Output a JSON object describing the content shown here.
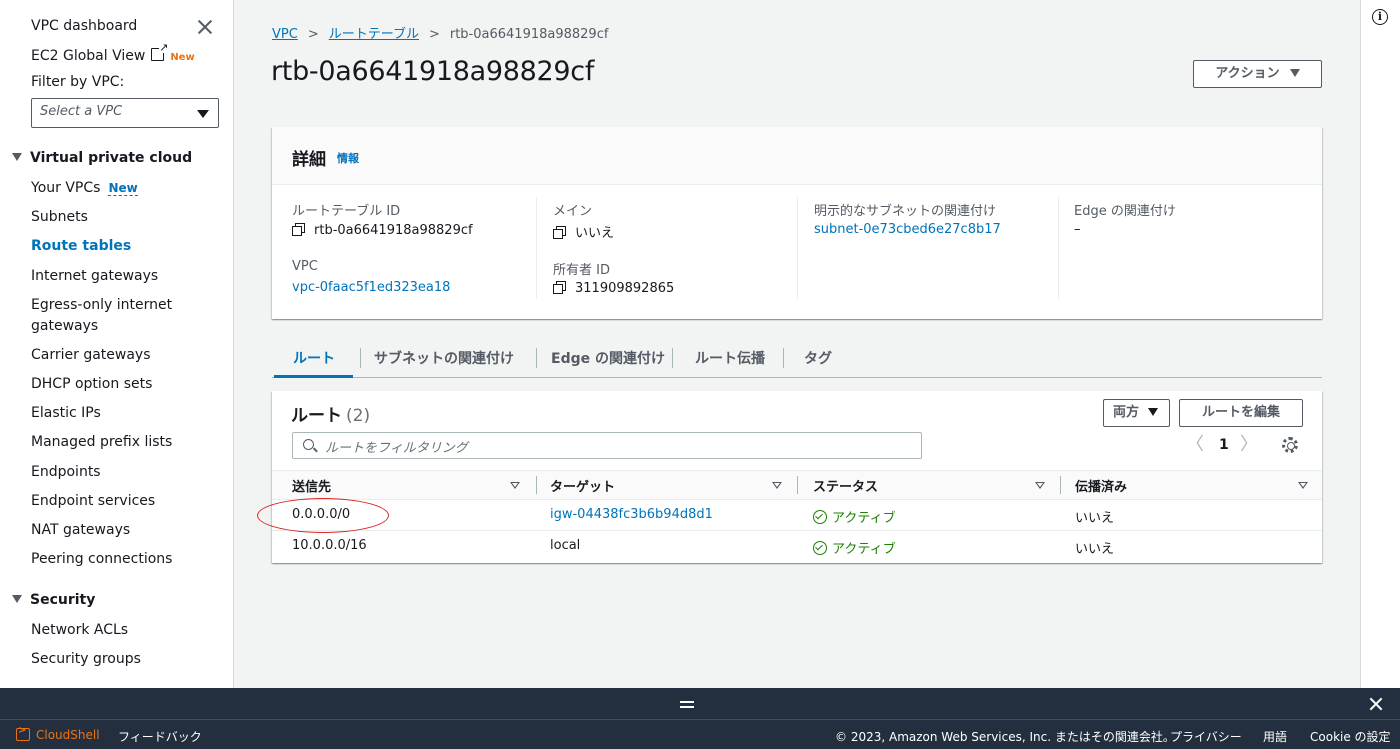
{
  "sidebar": {
    "dashboard": "VPC dashboard",
    "ec2_global_view": "EC2 Global View",
    "new_badge": "New",
    "filter_label": "Filter by VPC:",
    "filter_placeholder": "Select a VPC",
    "section_vpc": "Virtual private cloud",
    "items": [
      {
        "label": "Your VPCs",
        "badge": "New"
      },
      {
        "label": "Subnets"
      },
      {
        "label": "Route tables"
      },
      {
        "label": "Internet gateways"
      },
      {
        "label": "Egress-only internet"
      },
      {
        "label": "gateways"
      },
      {
        "label": "Carrier gateways"
      },
      {
        "label": "DHCP option sets"
      },
      {
        "label": "Elastic IPs"
      },
      {
        "label": "Managed prefix lists"
      },
      {
        "label": "Endpoints"
      },
      {
        "label": "Endpoint services"
      },
      {
        "label": "NAT gateways"
      },
      {
        "label": "Peering connections"
      }
    ],
    "section_security": "Security",
    "security_items": [
      "Network ACLs",
      "Security groups"
    ]
  },
  "breadcrumb": {
    "root": "VPC",
    "parent": "ルートテーブル",
    "current": "rtb-0a6641918a98829cf"
  },
  "page": {
    "title": "rtb-0a6641918a98829cf",
    "actions_label": "アクション"
  },
  "details": {
    "title": "詳細",
    "info": "情報",
    "route_table_id_label": "ルートテーブル ID",
    "route_table_id": "rtb-0a6641918a98829cf",
    "main_label": "メイン",
    "main_value": "いいえ",
    "subnet_assoc_label": "明示的なサブネットの関連付け",
    "subnet_assoc_value": "subnet-0e73cbed6e27c8b17",
    "edge_assoc_label": "Edge の関連付け",
    "edge_assoc_value": "–",
    "vpc_label": "VPC",
    "vpc_value": "vpc-0faac5f1ed323ea18",
    "owner_label": "所有者 ID",
    "owner_value": "311909892865"
  },
  "tabs": [
    "ルート",
    "サブネットの関連付け",
    "Edge の関連付け",
    "ルート伝播",
    "タグ"
  ],
  "routes": {
    "title": "ルート",
    "count": "(2)",
    "both_label": "両方",
    "edit_label": "ルートを編集",
    "filter_placeholder": "ルートをフィルタリング",
    "prev_icon": "〈",
    "next_icon": "〉",
    "page": "1",
    "columns": [
      "送信先",
      "ターゲット",
      "ステータス",
      "伝播済み"
    ],
    "rows": [
      {
        "destination": "0.0.0.0/0",
        "target": "igw-04438fc3b6b94d8d1",
        "status": "アクティブ",
        "propagated": "いいえ"
      },
      {
        "destination": "10.0.0.0/16",
        "target": "local",
        "status": "アクティブ",
        "propagated": "いいえ"
      }
    ]
  },
  "footer": {
    "cloudshell": "CloudShell",
    "feedback": "フィードバック",
    "copyright": "© 2023, Amazon Web Services, Inc. またはその関連会社。",
    "privacy": "プライバシー",
    "terms": "用語",
    "cookie": "Cookie の設定"
  },
  "colors": {
    "link": "#0073bb",
    "status_ok": "#1d8102",
    "badge_new": "#ec7211",
    "annotation": "#d5271f",
    "footer_bg": "#232f3e"
  }
}
